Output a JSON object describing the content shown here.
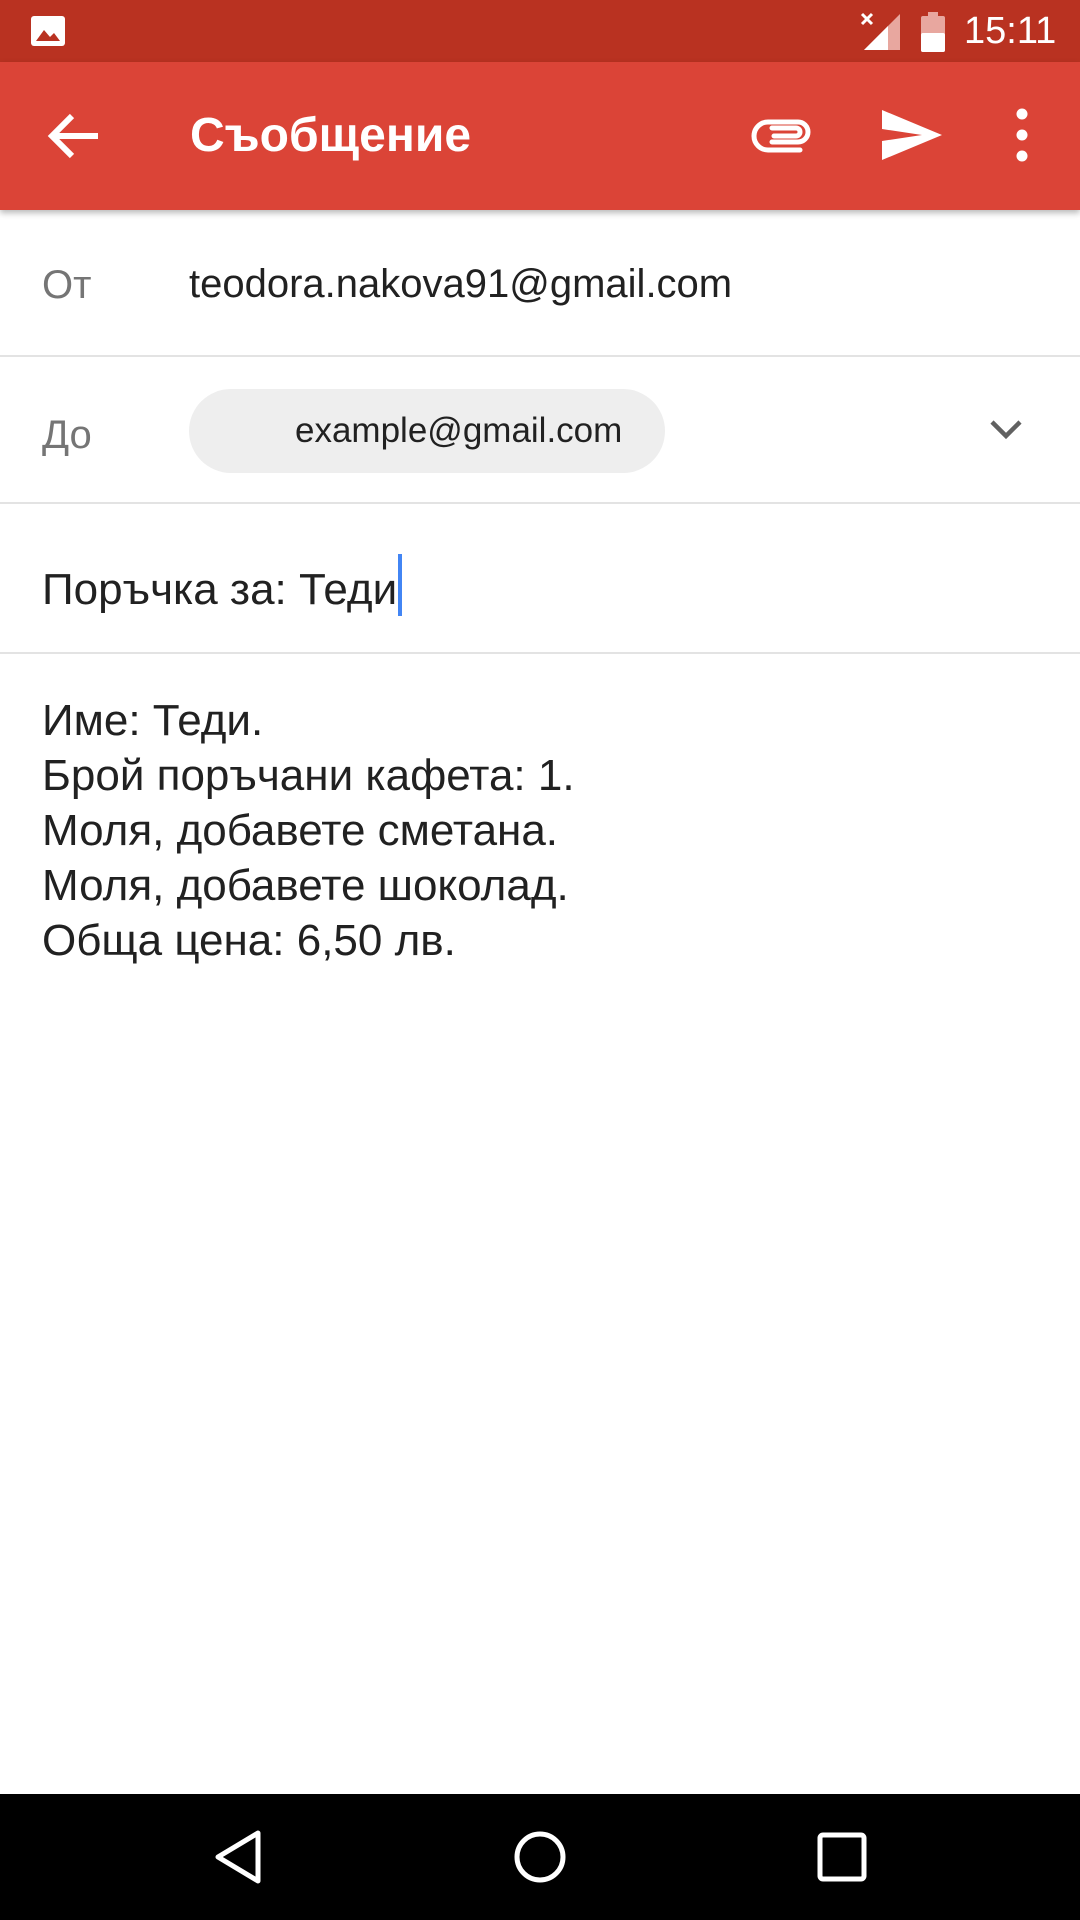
{
  "status_bar": {
    "time": "15:11",
    "icons": [
      "gallery-icon",
      "signal-no-data-icon",
      "battery-icon"
    ]
  },
  "app_bar": {
    "title": "Съобщение",
    "color": "#db4437",
    "icons": [
      "back-arrow-icon",
      "paperclip-icon",
      "send-icon",
      "more-vert-icon"
    ]
  },
  "compose": {
    "from_label": "От",
    "from_value": "teodora.nakova91@gmail.com",
    "to_label": "До",
    "to_chip": "example@gmail.com",
    "subject": "Поръчка за: Теди",
    "body_lines": [
      "Име: Теди.",
      "Брой поръчани кафета: 1.",
      "Моля, добавете сметана.",
      "Моля, добавете шоколад.",
      "Обща цена: 6,50 лв."
    ]
  },
  "nav_bar": {
    "icons": [
      "nav-back-icon",
      "nav-home-icon",
      "nav-recents-icon"
    ]
  }
}
